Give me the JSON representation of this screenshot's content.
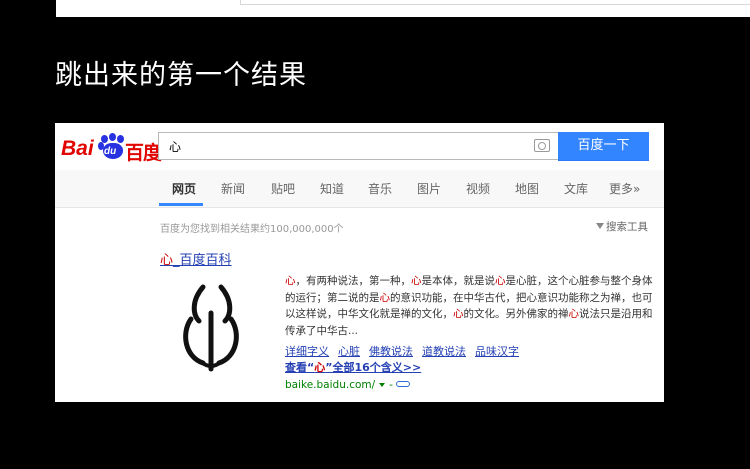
{
  "slide": {
    "title": "跳出来的第一个结果"
  },
  "logo": {
    "bai": "Bai",
    "du": "du",
    "cn": "百度"
  },
  "search": {
    "query": "心",
    "button_label": "百度一下",
    "camera_icon": "camera-icon"
  },
  "nav": {
    "tabs": [
      "网页",
      "新闻",
      "贴吧",
      "知道",
      "音乐",
      "图片",
      "视频",
      "地图",
      "文库",
      "更多»"
    ],
    "active": "网页"
  },
  "results_info": {
    "count_text": "百度为您找到相关结果约100,000,000个",
    "tools_label": "搜索工具"
  },
  "result": {
    "title_kw": "心",
    "title_rest": "_百度百科",
    "snippet": [
      {
        "t": "心",
        "kw": true
      },
      {
        "t": "，有两种说法，第一种，",
        "kw": false
      },
      {
        "t": "心",
        "kw": true
      },
      {
        "t": "是本体，就是说",
        "kw": false
      },
      {
        "t": "心",
        "kw": true
      },
      {
        "t": "是心脏，这个心脏参与整个身体的运行；第二说的是",
        "kw": false
      },
      {
        "t": "心",
        "kw": true
      },
      {
        "t": "的意识功能，在中华古代，把心意识功能称之为禅，也可以这样说，中华文化就是禅的文化，",
        "kw": false
      },
      {
        "t": "心",
        "kw": true
      },
      {
        "t": "的文化。另外佛家的禅",
        "kw": false
      },
      {
        "t": "心",
        "kw": true
      },
      {
        "t": "说法只是沿用和传承了中华古...",
        "kw": false
      }
    ],
    "links": [
      "详细字义",
      "心脏",
      "佛教说法",
      "道教说法",
      "品味汉字"
    ],
    "more_prefix": "查看“",
    "more_kw": "心",
    "more_suffix": "”全部16个含义>>",
    "url": "baike.baidu.com/",
    "url_dash": "-"
  }
}
